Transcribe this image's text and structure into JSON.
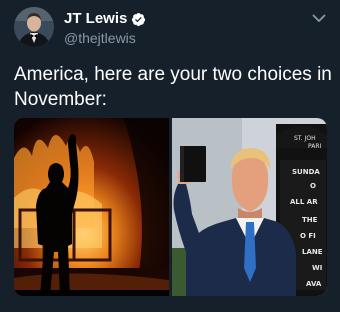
{
  "tweet": {
    "author": {
      "display_name": "JT Lewis",
      "handle": "@thejtlewis",
      "verified": true
    },
    "text": "America, here are your two choices in November:",
    "media": {
      "left_photo": "person-silhouette-in-front-of-fire",
      "right_photo": {
        "subject": "man-holding-bible",
        "sign_text": [
          "ST. JOH",
          "PARI",
          "SUNDA",
          "O",
          "ALL AR",
          "THE",
          "O FI",
          "LANE",
          "WI",
          "AVA"
        ]
      }
    },
    "icons": {
      "verified": "verified-badge-icon",
      "more": "chevron-down-icon"
    },
    "colors": {
      "background": "#15202b",
      "text": "#ffffff",
      "secondary_text": "#8899a6",
      "verified_blue": "#1da1f2"
    }
  }
}
